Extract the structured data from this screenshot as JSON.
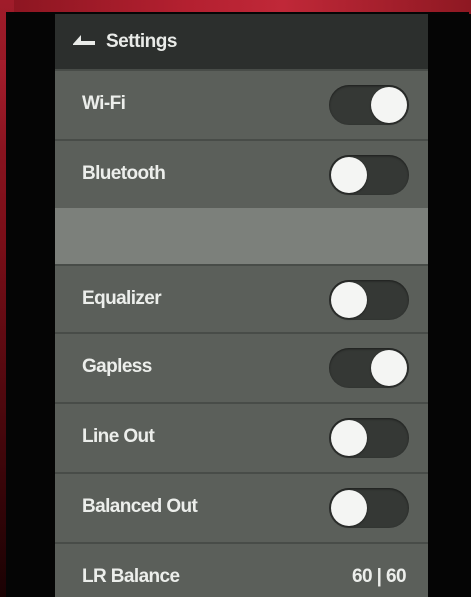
{
  "header": {
    "title": "Settings",
    "back_icon": "back-arrow-icon"
  },
  "settings": [
    {
      "label": "Wi-Fi",
      "state": "on"
    },
    {
      "label": "Bluetooth",
      "state": "off"
    },
    {
      "label": "Equalizer",
      "state": "off"
    },
    {
      "label": "Gapless",
      "state": "on"
    },
    {
      "label": "Line Out",
      "state": "off"
    },
    {
      "label": "Balanced Out",
      "state": "off"
    }
  ],
  "lr_balance": {
    "label": "LR Balance",
    "value": "60 | 60"
  },
  "colors": {
    "device_red": "#b42030",
    "screen_bg": "#5b5f5a",
    "header_bg": "#2c2f2d",
    "toggle_track": "#353835",
    "knob": "#f4f5f3"
  }
}
